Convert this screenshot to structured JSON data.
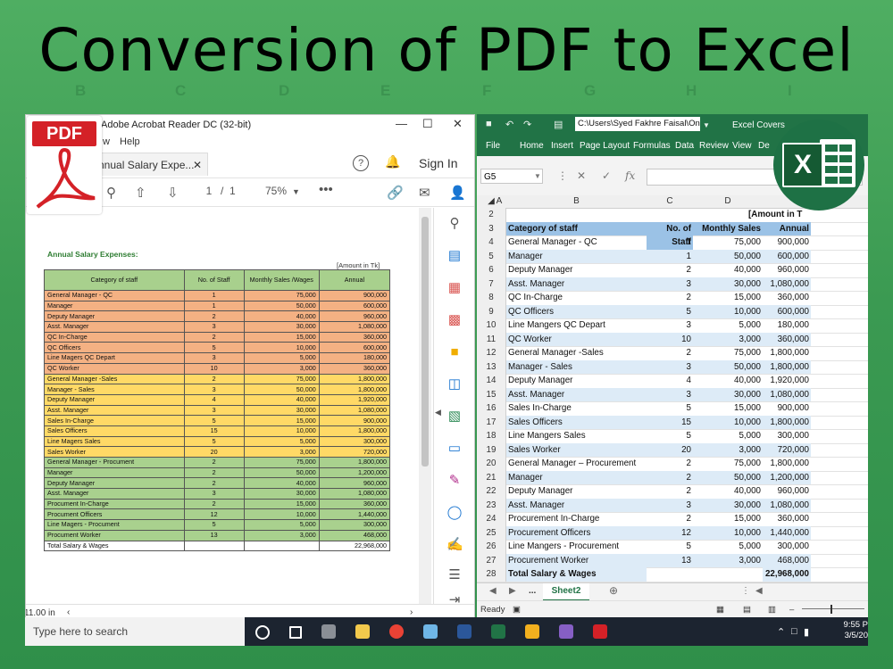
{
  "slide_title": "Conversion of PDF to Excel",
  "acrobat": {
    "window_title": "Adobe Acrobat Reader DC (32-bit)",
    "menu_items": [
      "w",
      "Help"
    ],
    "tab_title": "nnual Salary Expe...",
    "sign_in": "Sign In",
    "page_current": "1",
    "page_sep": "/",
    "page_total": "1",
    "zoom": "75%",
    "status_size": "11.00 in",
    "logo_label": "PDF",
    "doc": {
      "caption": "Annual Salary Expenses:",
      "amount_note": "[Amount in Tk]",
      "headers": [
        "Category of staff",
        "No. of Staff",
        "Monthly Sales /Wages",
        "Annual"
      ],
      "rows": [
        [
          "General Manager - QC",
          "1",
          "75,000",
          "900,000"
        ],
        [
          "Manager",
          "1",
          "50,000",
          "600,000"
        ],
        [
          "Deputy Manager",
          "2",
          "40,000",
          "960,000"
        ],
        [
          "Asst. Manager",
          "3",
          "30,000",
          "1,080,000"
        ],
        [
          "QC In-Charge",
          "2",
          "15,000",
          "360,000"
        ],
        [
          "QC Officers",
          "5",
          "10,000",
          "600,000"
        ],
        [
          "Line Magers QC Depart",
          "3",
          "5,000",
          "180,000"
        ],
        [
          "QC Worker",
          "10",
          "3,000",
          "360,000"
        ],
        [
          "General Manager -Sales",
          "2",
          "75,000",
          "1,800,000"
        ],
        [
          "Manager - Sales",
          "3",
          "50,000",
          "1,800,000"
        ],
        [
          "Deputy Manager",
          "4",
          "40,000",
          "1,920,000"
        ],
        [
          "Asst. Manager",
          "3",
          "30,000",
          "1,080,000"
        ],
        [
          "Sales In-Charge",
          "5",
          "15,000",
          "900,000"
        ],
        [
          "Sales Officers",
          "15",
          "10,000",
          "1,800,000"
        ],
        [
          "Line Magers Sales",
          "5",
          "5,000",
          "300,000"
        ],
        [
          "Sales Worker",
          "20",
          "3,000",
          "720,000"
        ],
        [
          "General Manager - Procument",
          "2",
          "75,000",
          "1,800,000"
        ],
        [
          "Manager",
          "2",
          "50,000",
          "1,200,000"
        ],
        [
          "Deputy Manager",
          "2",
          "40,000",
          "960,000"
        ],
        [
          "Asst. Manager",
          "3",
          "30,000",
          "1,080,000"
        ],
        [
          "Procument In-Charge",
          "2",
          "15,000",
          "360,000"
        ],
        [
          "Procument  Officers",
          "12",
          "10,000",
          "1,440,000"
        ],
        [
          "Line Magers - Procument",
          "5",
          "5,000",
          "300,000"
        ],
        [
          "Procument  Worker",
          "13",
          "3,000",
          "468,000"
        ]
      ],
      "total_label": "Total Salary & Wages",
      "total_value": "22,968,000"
    }
  },
  "excel": {
    "path": "C:\\Users\\Syed Fakhre Faisal\\On",
    "file_name": "Excel Covers",
    "ribbon_tabs": [
      "File",
      "Home",
      "Insert",
      "Page Layout",
      "Formulas",
      "Data",
      "Review",
      "View",
      "De"
    ],
    "name_box": "G5",
    "fx": "fx",
    "columns": [
      "A",
      "B",
      "C",
      "D"
    ],
    "amount_note": "[Amount in T",
    "header_row": [
      "Category of staff",
      "No. of Staff",
      "Monthly Sales",
      "Annual"
    ],
    "rows": [
      [
        "General Manager - QC",
        "1",
        "75,000",
        "900,000"
      ],
      [
        "Manager",
        "1",
        "50,000",
        "600,000"
      ],
      [
        "Deputy Manager",
        "2",
        "40,000",
        "960,000"
      ],
      [
        "Asst. Manager",
        "3",
        "30,000",
        "1,080,000"
      ],
      [
        "QC In-Charge",
        "2",
        "15,000",
        "360,000"
      ],
      [
        "QC Officers",
        "5",
        "10,000",
        "600,000"
      ],
      [
        "Line Mangers QC Depart",
        "3",
        "5,000",
        "180,000"
      ],
      [
        "QC Worker",
        "10",
        "3,000",
        "360,000"
      ],
      [
        "General Manager -Sales",
        "2",
        "75,000",
        "1,800,000"
      ],
      [
        "Manager - Sales",
        "3",
        "50,000",
        "1,800,000"
      ],
      [
        "Deputy Manager",
        "4",
        "40,000",
        "1,920,000"
      ],
      [
        "Asst. Manager",
        "3",
        "30,000",
        "1,080,000"
      ],
      [
        "Sales In-Charge",
        "5",
        "15,000",
        "900,000"
      ],
      [
        "Sales Officers",
        "15",
        "10,000",
        "1,800,000"
      ],
      [
        "Line Mangers Sales",
        "5",
        "5,000",
        "300,000"
      ],
      [
        "Sales Worker",
        "20",
        "3,000",
        "720,000"
      ],
      [
        "General Manager – Procurement",
        "2",
        "75,000",
        "1,800,000"
      ],
      [
        "Manager",
        "2",
        "50,000",
        "1,200,000"
      ],
      [
        "Deputy Manager",
        "2",
        "40,000",
        "960,000"
      ],
      [
        "Asst. Manager",
        "3",
        "30,000",
        "1,080,000"
      ],
      [
        "Procurement In-Charge",
        "2",
        "15,000",
        "360,000"
      ],
      [
        "Procurement Officers",
        "12",
        "10,000",
        "1,440,000"
      ],
      [
        "Line Mangers - Procurement",
        "5",
        "5,000",
        "300,000"
      ],
      [
        "Procurement Worker",
        "13",
        "3,000",
        "468,000"
      ]
    ],
    "total_label": "Total Salary & Wages",
    "total_value": "22,968,000",
    "sheet_tab": "Sheet2",
    "tab_ellipsis": "...",
    "status": "Ready"
  },
  "taskbar": {
    "search_placeholder": "Type here to search",
    "time": "9:55 P",
    "date": "3/5/20"
  }
}
